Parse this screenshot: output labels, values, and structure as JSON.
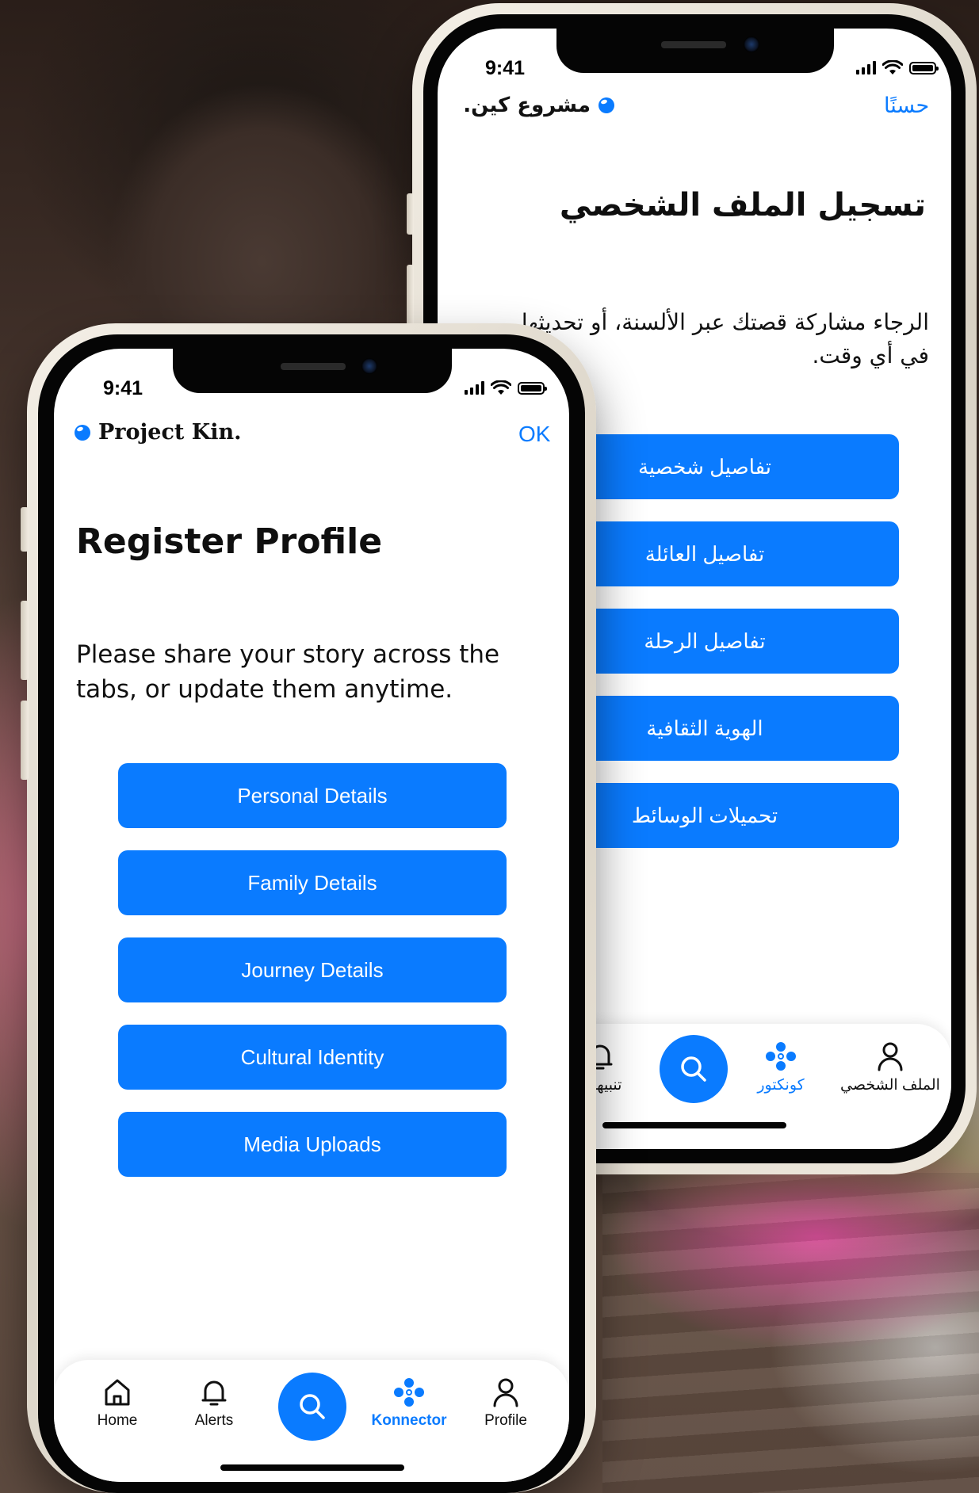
{
  "colors": {
    "accent": "#0a7bff",
    "screen_bg": "#ffffff",
    "text": "#111111"
  },
  "arabic_phone": {
    "status": {
      "time": "9:41"
    },
    "header": {
      "brand_name": "مشروع كين.",
      "ok_label": "حسنًا"
    },
    "title": "تسجيل الملف الشخصي",
    "description": "الرجاء مشاركة قصتك عبر الألسنة، أو تحديثها في أي وقت.",
    "menu": [
      {
        "label": "تفاصيل شخصية"
      },
      {
        "label": "تفاصيل العائلة"
      },
      {
        "label": "تفاصيل الرحلة"
      },
      {
        "label": "الهوية الثقافية"
      },
      {
        "label": "تحميلات الوسائط"
      }
    ],
    "tabbar": {
      "alerts_label": "تنبيهات",
      "konnector_label": "كونكتور",
      "profile_label": "الملف الشخصي",
      "active_tab": "konnector"
    }
  },
  "english_phone": {
    "status": {
      "time": "9:41"
    },
    "header": {
      "brand_name": "Project Kin.",
      "ok_label": "OK"
    },
    "title": "Register Profile",
    "description": "Please share your story across the tabs, or update them anytime.",
    "menu": [
      {
        "label": "Personal Details"
      },
      {
        "label": "Family Details"
      },
      {
        "label": "Journey Details"
      },
      {
        "label": "Cultural Identity"
      },
      {
        "label": "Media Uploads"
      }
    ],
    "tabbar": {
      "home_label": "Home",
      "alerts_label": "Alerts",
      "konnector_label": "Konnector",
      "profile_label": "Profile",
      "active_tab": "konnector"
    }
  },
  "icons": {
    "home": "home-icon",
    "alerts": "bell-icon",
    "search": "search-icon",
    "konnector": "connector-dots-icon",
    "profile": "person-icon",
    "signal": "cellular-signal-icon",
    "wifi": "wifi-icon",
    "battery": "battery-icon",
    "brand": "brand-dot-icon"
  }
}
